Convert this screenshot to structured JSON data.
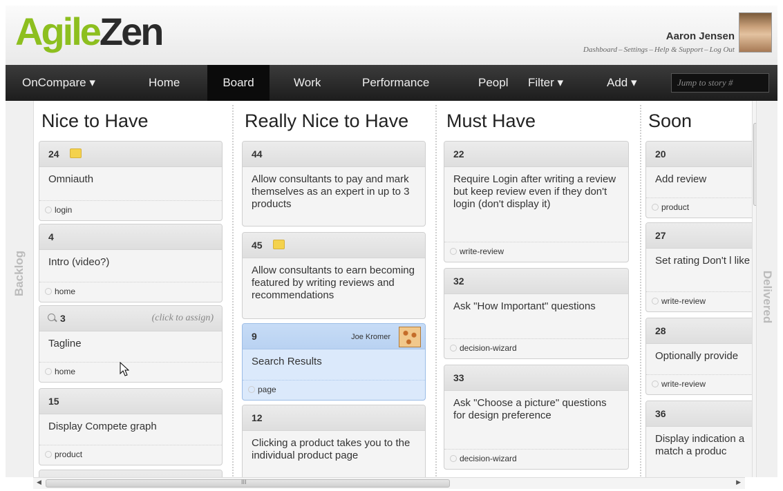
{
  "header": {
    "logo_part1": "Agile",
    "logo_part2": "Zen",
    "user_name": "Aaron Jensen",
    "links": [
      "Dashboard",
      "Settings",
      "Help & Support",
      "Log Out"
    ]
  },
  "nav": {
    "items": [
      {
        "label": "OnCompare ▾"
      },
      {
        "label": "Home"
      },
      {
        "label": "Board"
      },
      {
        "label": "Work"
      },
      {
        "label": "Performance"
      },
      {
        "label": "Peopl"
      },
      {
        "label": "Filter ▾"
      },
      {
        "label": "Add ▾"
      }
    ],
    "search_placeholder": "Jump to story #"
  },
  "board": {
    "backlog_label": "Backlog",
    "delivered_label": "Delivered",
    "columns": [
      {
        "title": "Nice to Have",
        "cards": [
          {
            "number": "24",
            "title": "Omniauth",
            "tag": "login",
            "flag": true
          },
          {
            "number": "4",
            "title": "Intro (video?)",
            "tag": "home"
          },
          {
            "number": "3",
            "title": "Tagline",
            "tag": "home",
            "assign": "(click to assign)"
          },
          {
            "number": "15",
            "title": "Display Compete graph",
            "tag": "product"
          }
        ]
      },
      {
        "title": "Really Nice to Have",
        "cards": [
          {
            "number": "44",
            "title": "Allow consultants to pay and mark themselves as an expert in up to 3 products"
          },
          {
            "number": "45",
            "title": "Allow consultants to earn becoming featured by writing reviews and recommendations",
            "flag": true
          },
          {
            "number": "9",
            "title": "Search Results",
            "tag": "page",
            "owner": "Joe Kromer"
          },
          {
            "number": "12",
            "title": "Clicking a product takes you to the individual product page"
          }
        ]
      },
      {
        "title": "Must Have",
        "cards": [
          {
            "number": "22",
            "title": "Require Login after writing a review but keep review even if they don't login (don't display it)",
            "tag": "write-review"
          },
          {
            "number": "32",
            "title": "Ask \"How Important\" questions",
            "tag": "decision-wizard"
          },
          {
            "number": "33",
            "title": "Ask \"Choose a picture\" questions for design preference",
            "tag": "decision-wizard"
          }
        ]
      },
      {
        "title": "Soon",
        "cards": [
          {
            "number": "20",
            "title": "Add review",
            "tag": "product"
          },
          {
            "number": "27",
            "title": "Set rating Don't l like",
            "tag": "write-review"
          },
          {
            "number": "28",
            "title": "Optionally provide",
            "tag": "write-review"
          },
          {
            "number": "36",
            "title": "Display indication a match a produc"
          }
        ]
      }
    ]
  },
  "scrollbars": {
    "h_grip": "III"
  }
}
